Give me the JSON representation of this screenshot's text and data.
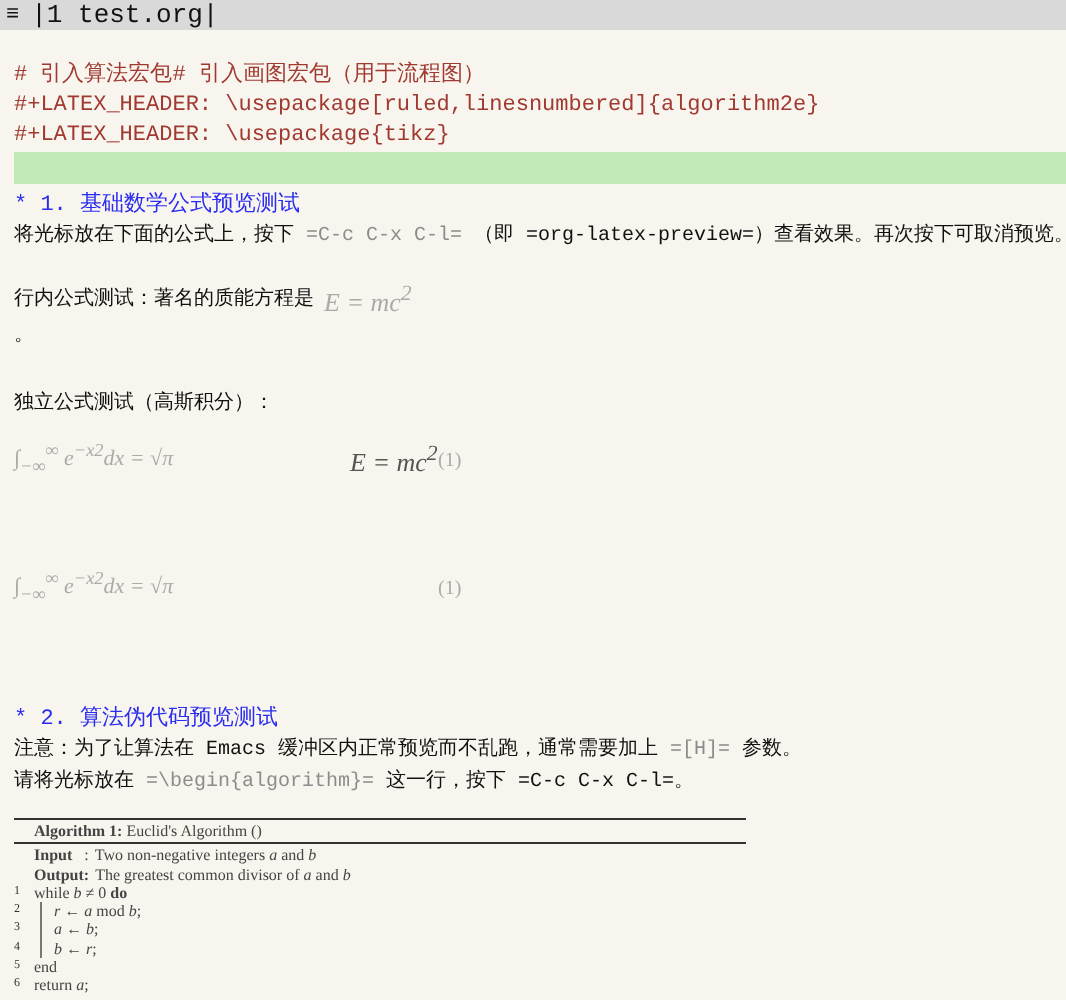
{
  "header": {
    "menu_glyph": "≡",
    "buffer": "|1 test.org|"
  },
  "comments": [
    "# 引入算法宏包# 引入画图宏包（用于流程图）",
    "#+LATEX_HEADER: \\usepackage[ruled,linesnumbered]{algorithm2e}",
    "#+LATEX_HEADER: \\usepackage{tikz}"
  ],
  "current_line": {
    "highlighted": true
  },
  "section_1": {
    "heading": "* 1. 基础数学公式预览测试",
    "paragraph": [
      {
        "kind": "text",
        "text": "将光标放在下面的公式上，按下 "
      },
      {
        "kind": "verbatim",
        "text": "=C-c C-x C-l="
      },
      {
        "kind": "text",
        "text": " （即 =org-latex-preview=）查看效果。再次按下可取消预览。"
      }
    ],
    "inline_label": "行内公式测试：著名的质能方程是",
    "inline_formula": "E = mc$^{2}$",
    "inline_tail": "。",
    "display_label": "独立公式测试（高斯积分）：",
    "display_rows": [
      {
        "formula": "∫$_{−∞}$$^{∞}$ e$^{−x2}$dx = √π",
        "center_formula": "E = mc$^{2}$",
        "tag": "(1)"
      },
      {
        "formula": "∫$_{−∞}$$^{∞}$ e$^{−x2}$dx = √π",
        "tag": "(1)"
      }
    ]
  },
  "section_2": {
    "heading": "* 2. 算法伪代码预览测试",
    "lines": [
      [
        {
          "kind": "text",
          "text": "注意：为了让算法在 Emacs 缓冲区内正常预览而不乱跑，通常需要加上 "
        },
        {
          "kind": "verbatim",
          "text": "=[H]="
        },
        {
          "kind": "text",
          "text": " 参数。"
        }
      ],
      [
        {
          "kind": "text",
          "text": "请将光标放在 "
        },
        {
          "kind": "verbatim",
          "text": "=\\begin{algorithm}="
        },
        {
          "kind": "text",
          "text": " 这一行，按下 =C-c C-x C-l=。"
        }
      ]
    ]
  },
  "algorithm": {
    "caption_label": "Algorithm 1:",
    "caption": "Euclid's Algorithm ()",
    "io": [
      {
        "label": "Input",
        "sep": ":",
        "text": "Two non-negative integers *a* and *b*"
      },
      {
        "label": "Output:",
        "text": "The greatest common divisor of *a* and *b*"
      }
    ],
    "steps": [
      {
        "number": "1",
        "text": "while *b* ≠ 0 **do**",
        "children": [
          {
            "number": "2",
            "text": "*r* ← *a* mod *b*;"
          },
          {
            "number": "3",
            "text": "*a* ← *b*;"
          },
          {
            "number": "4",
            "text": "*b* ← *r*;"
          }
        ]
      },
      {
        "number": "5",
        "text": "end"
      },
      {
        "number": "6",
        "text": "return *a*;"
      }
    ]
  }
}
